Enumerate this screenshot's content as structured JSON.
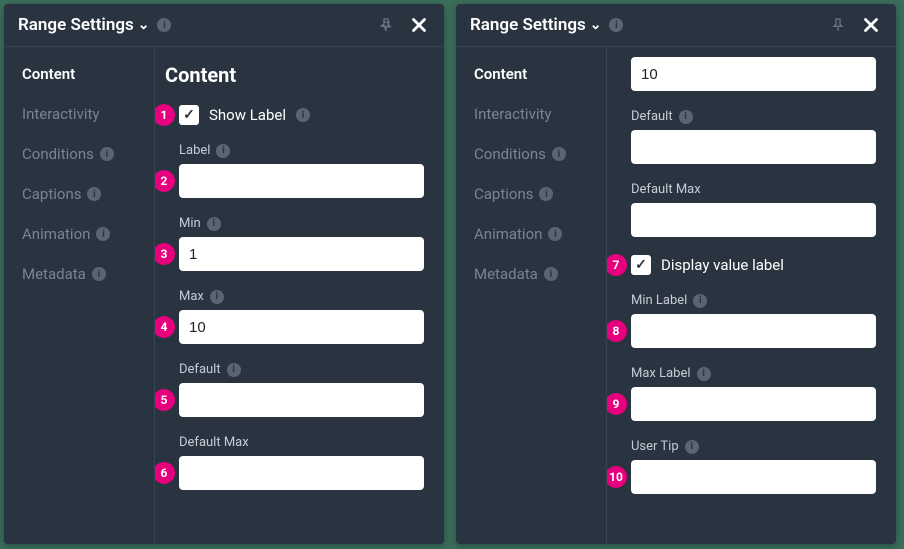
{
  "panelTitle": "Range Settings",
  "sidebar": {
    "items": [
      {
        "label": "Content",
        "active": true,
        "info": false
      },
      {
        "label": "Interactivity",
        "active": false,
        "info": false
      },
      {
        "label": "Conditions",
        "active": false,
        "info": true
      },
      {
        "label": "Captions",
        "active": false,
        "info": true
      },
      {
        "label": "Animation",
        "active": false,
        "info": true
      },
      {
        "label": "Metadata",
        "active": false,
        "info": true
      }
    ]
  },
  "left": {
    "sectionTitle": "Content",
    "fields": {
      "showLabel": {
        "label": "Show Label",
        "checked": true,
        "marker": "1"
      },
      "label": {
        "label": "Label",
        "value": "",
        "marker": "2"
      },
      "min": {
        "label": "Min",
        "value": "1",
        "marker": "3"
      },
      "max": {
        "label": "Max",
        "value": "10",
        "marker": "4"
      },
      "default": {
        "label": "Default",
        "value": "",
        "marker": "5"
      },
      "defaultMax": {
        "label": "Default Max",
        "value": "",
        "marker": "6"
      }
    }
  },
  "right": {
    "fields": {
      "topVal": {
        "value": "10"
      },
      "default": {
        "label": "Default",
        "value": ""
      },
      "defaultMax": {
        "label": "Default Max",
        "value": ""
      },
      "displayValueLabel": {
        "label": "Display value label",
        "checked": true,
        "marker": "7"
      },
      "minLabel": {
        "label": "Min Label",
        "value": "",
        "marker": "8"
      },
      "maxLabel": {
        "label": "Max Label",
        "value": "",
        "marker": "9"
      },
      "userTip": {
        "label": "User Tip",
        "value": "",
        "marker": "10"
      }
    }
  }
}
